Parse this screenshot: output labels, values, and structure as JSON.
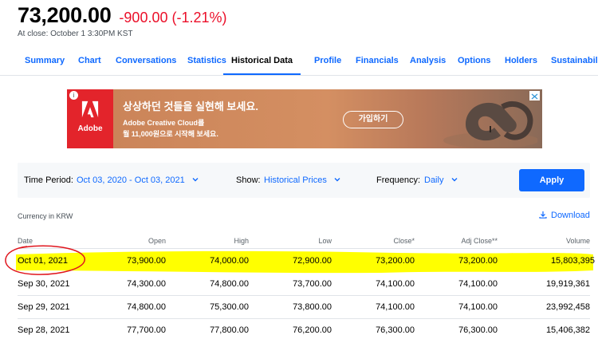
{
  "quote": {
    "price": "73,200.00",
    "change": "-900.00 (-1.21%)",
    "close_time": "At close: October 1 3:30PM KST"
  },
  "tabs": [
    {
      "label": "Summary"
    },
    {
      "label": "Chart"
    },
    {
      "label": "Conversations"
    },
    {
      "label": "Statistics"
    },
    {
      "label": "Historical Data",
      "active": true
    },
    {
      "label": "Profile"
    },
    {
      "label": "Financials"
    },
    {
      "label": "Analysis"
    },
    {
      "label": "Options"
    },
    {
      "label": "Holders"
    },
    {
      "label": "Sustainability"
    }
  ],
  "ad": {
    "brand": "Adobe",
    "headline": "상상하던 것들을 실현해 보세요.",
    "sub1": "Adobe Creative Cloud를",
    "sub2": "월 11,000원으로 시작해 보세요.",
    "cta": "가입하기",
    "info_icon": "info-icon",
    "choices_icon": "adchoices-close-icon"
  },
  "filters": {
    "time_period_label": "Time Period:",
    "time_period_value": "Oct 03, 2020 - Oct 03, 2021",
    "show_label": "Show:",
    "show_value": "Historical Prices",
    "frequency_label": "Frequency:",
    "frequency_value": "Daily",
    "apply_label": "Apply"
  },
  "currency_note": "Currency in KRW",
  "download_label": "Download",
  "table": {
    "columns": [
      "Date",
      "Open",
      "High",
      "Low",
      "Close*",
      "Adj Close**",
      "Volume"
    ],
    "rows": [
      [
        "Oct 01, 2021",
        "73,900.00",
        "74,000.00",
        "72,900.00",
        "73,200.00",
        "73,200.00",
        "15,803,395"
      ],
      [
        "Sep 30, 2021",
        "74,300.00",
        "74,800.00",
        "73,700.00",
        "74,100.00",
        "74,100.00",
        "19,919,361"
      ],
      [
        "Sep 29, 2021",
        "74,800.00",
        "75,300.00",
        "73,800.00",
        "74,100.00",
        "74,100.00",
        "23,992,458"
      ],
      [
        "Sep 28, 2021",
        "77,700.00",
        "77,800.00",
        "76,200.00",
        "76,300.00",
        "76,300.00",
        "15,406,382"
      ]
    ]
  },
  "colors": {
    "accent": "#0f69ff",
    "negative": "#eb0f29",
    "highlight": "#ffff00",
    "annotation": "#e0161e"
  }
}
